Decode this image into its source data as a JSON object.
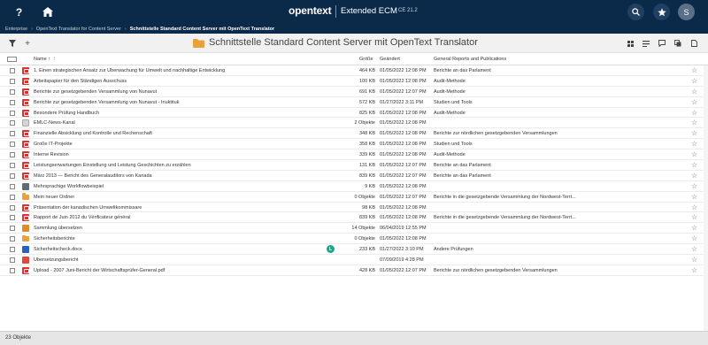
{
  "header": {
    "brand": "opentext",
    "product": "Extended ECM",
    "version": "CE 21.2",
    "user_initial": "S",
    "help_glyph": "?"
  },
  "breadcrumb": {
    "items": [
      "Enterprise",
      "OpenText Translator for Content Server"
    ],
    "current": "Schnittstelle Standard Content Server mit OpenText Translator"
  },
  "title": {
    "text": "Schnittstelle Standard Content Server mit OpenText Translator"
  },
  "columns": {
    "name": "Name",
    "size": "Größe",
    "modified": "Geändert",
    "general": "General Reports and Publications"
  },
  "colors": {
    "header_bg": "#0b2a4a",
    "pdf": "#e02f2f",
    "folder": "#e9a23b",
    "badge": "#1aa68a"
  },
  "rows": [
    {
      "icon": "pdf-icon",
      "name": "1. Einen strategischen Ansatz zur Überwachung für Umwelt und nachhaltige Entwicklung",
      "size": "464 KB",
      "modified": "01/05/2022 12:08 PM",
      "general": "Berichte an das Parlament"
    },
    {
      "icon": "pdf-icon",
      "name": "Arbeitspapier für den Ständigen Ausschuss",
      "size": "100 KB",
      "modified": "01/05/2022 12:08 PM",
      "general": "Audit-Methode"
    },
    {
      "icon": "pdf-icon",
      "name": "Berichte zur gesetzgebenden Versammlung von Nunavut",
      "size": "691 KB",
      "modified": "01/05/2022 12:07 PM",
      "general": "Audit-Methode"
    },
    {
      "icon": "pdf-icon",
      "name": "Berichte zur gesetzgebenden Versammlung von Nunavut - Inuktituk",
      "size": "572 KB",
      "modified": "01/27/2022 3:11 PM",
      "general": "Studien und Tools"
    },
    {
      "icon": "pdf-icon",
      "name": "Besondere Prüfung Handbuch",
      "size": "825 KB",
      "modified": "01/05/2022 12:08 PM",
      "general": "Audit-Methode"
    },
    {
      "icon": "news-icon",
      "name": "EMLC-News-Kanal",
      "size": "2 Objekte",
      "modified": "01/05/2022 12:08 PM",
      "general": ""
    },
    {
      "icon": "pdf-icon",
      "name": "Finanzielle Absicklung und Kontrolle und Rechenschaft",
      "size": "348 KB",
      "modified": "01/05/2022 12:08 PM",
      "general": "Berichte zur nördlichen gesetzgebenden Versammlungen"
    },
    {
      "icon": "pdf-icon",
      "name": "Große IT-Projekte",
      "size": "358 KB",
      "modified": "01/05/2022 12:08 PM",
      "general": "Studien und Tools"
    },
    {
      "icon": "pdf-icon",
      "name": "Interne Revision",
      "size": "339 KB",
      "modified": "01/05/2022 12:08 PM",
      "general": "Audit-Methode"
    },
    {
      "icon": "pdf-icon",
      "name": "Leistungserwartungen Einstellung und Leistung Geschichten zu erzählen",
      "size": "131 KB",
      "modified": "01/05/2022 12:07 PM",
      "general": "Berichte an das Parlament"
    },
    {
      "icon": "pdf-icon",
      "name": "März 2013 — Bericht des Generalauditors von Kanada",
      "size": "839 KB",
      "modified": "01/05/2022 12:07 PM",
      "general": "Berichte an das Parlament"
    },
    {
      "icon": "workflow-icon",
      "name": "Mehrsprachige Workflowbeispiel",
      "size": "9 KB",
      "modified": "01/05/2022 12:08 PM",
      "general": ""
    },
    {
      "icon": "folder-icon",
      "name": "Mein neuer Ordner",
      "size": "0 Objekte",
      "modified": "01/05/2022 12:07 PM",
      "general": "Berichte in die gesetzgebende Versammlung der Nordwest-Terrt..."
    },
    {
      "icon": "pdf-icon",
      "name": "Präsentation der kanadischen Umweltkommissare",
      "size": "98 KB",
      "modified": "01/05/2022 12:08 PM",
      "general": ""
    },
    {
      "icon": "pdf-icon",
      "name": "Rapport de Juin 2012 du Vérificateur général",
      "size": "839 KB",
      "modified": "01/05/2022 12:08 PM",
      "general": "Berichte in die gesetzgebende Versammlung der Nordwest-Terrt..."
    },
    {
      "icon": "collection-icon",
      "name": "Sammlung übersetzen",
      "size": "14 Objekte",
      "modified": "06/04/2019 12:55 PM",
      "general": ""
    },
    {
      "icon": "folder-icon",
      "name": "Sicherheitsberichte",
      "size": "0 Objekte",
      "modified": "01/05/2022 12:08 PM",
      "general": ""
    },
    {
      "icon": "docx-icon",
      "name": "Sicherheitscheck.docx",
      "size": "233 KB",
      "modified": "01/27/2022 3:10 PM",
      "general": "Andere Prüfungen",
      "badge": "L"
    },
    {
      "icon": "page-icon",
      "name": "Übersetzungsbericht",
      "size": "",
      "modified": "07/09/2019 4:28 PM",
      "general": ""
    },
    {
      "icon": "pdf-icon",
      "name": "Upload - 2007 Juni-Bericht der Wirtschaftsprüfer-General.pdf",
      "size": "428 KB",
      "modified": "01/05/2022 12:07 PM",
      "general": "Berichte zur nördlichen gesetzgebenden Versammlungen"
    }
  ],
  "footer": {
    "count": "23 Objekte"
  }
}
